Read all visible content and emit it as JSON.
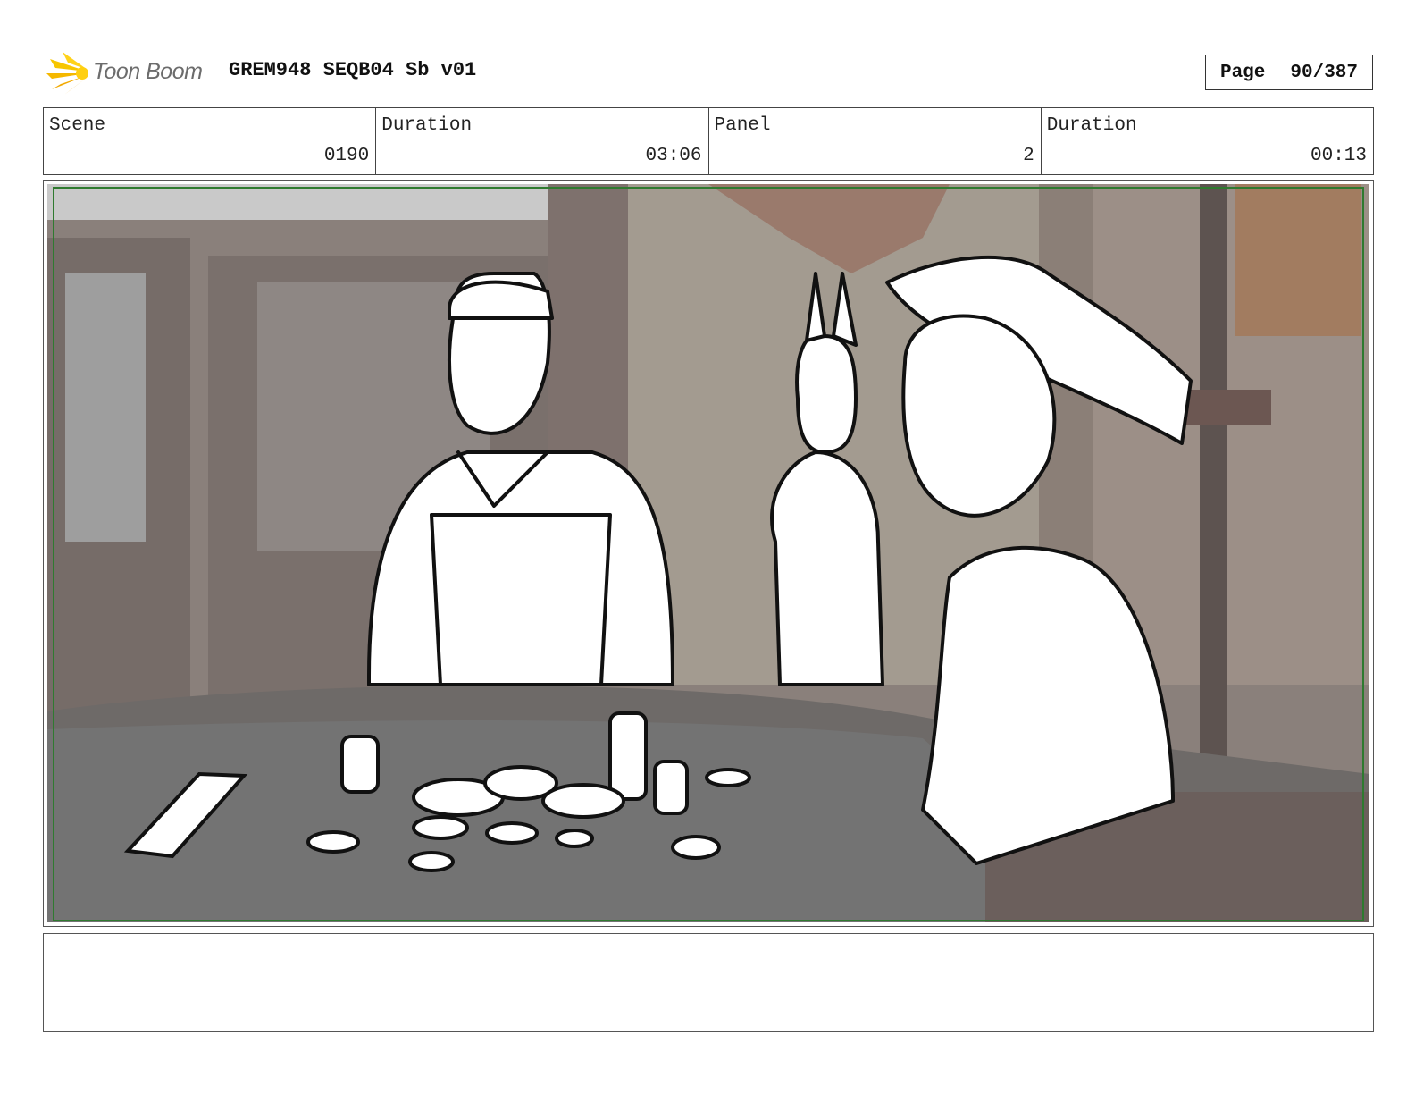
{
  "header": {
    "logo_text": "Toon Boom",
    "doc_title": "GREM948 SEQB04 Sb v01",
    "page_label": "Page",
    "page_value": "90/387"
  },
  "info": {
    "scene": {
      "label": "Scene",
      "value": "0190"
    },
    "scene_duration": {
      "label": "Duration",
      "value": "03:06"
    },
    "panel": {
      "label": "Panel",
      "value": "2"
    },
    "panel_duration": {
      "label": "Duration",
      "value": "00:13"
    }
  },
  "panel_image": {
    "description_icon": "storyboard-drawing",
    "safe_frame_color": "#2f7a2f"
  },
  "notes": {
    "text": ""
  },
  "colors": {
    "logo_accent": "#f5c400",
    "logo_text": "#6c6c6c"
  }
}
